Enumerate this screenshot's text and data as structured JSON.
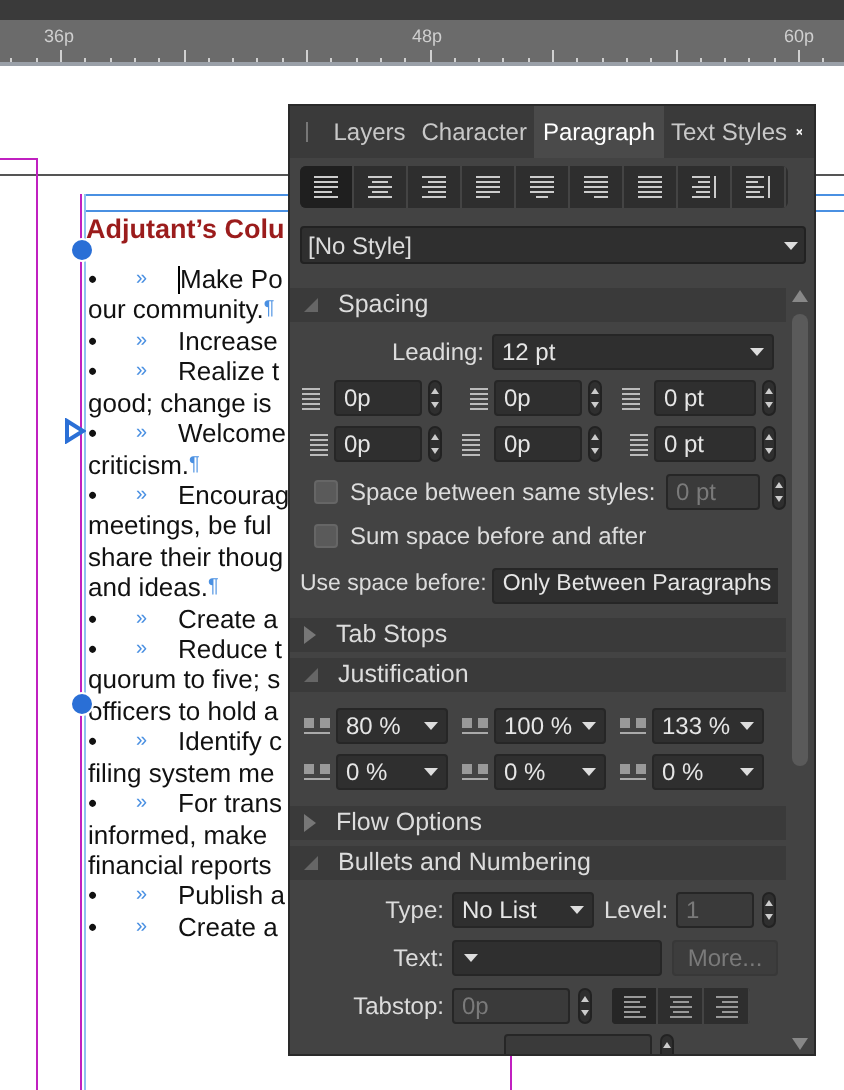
{
  "ruler": {
    "labels": [
      "36p",
      "48p",
      "60p"
    ]
  },
  "document": {
    "heading": "Adjutant’s Colu",
    "lines": [
      {
        "bullet": "•",
        "tab": "»",
        "text": "Make Po",
        "cursor": true
      },
      {
        "text": "our community.",
        "end_mark": "¶"
      },
      {
        "bullet": "•",
        "tab": "»",
        "text": "Increase"
      },
      {
        "bullet": "•",
        "tab": "»",
        "text": "Realize t"
      },
      {
        "text": "good; change is"
      },
      {
        "bullet": "•",
        "tab": "»",
        "text": "Welcome"
      },
      {
        "text": "criticism.",
        "end_mark": "¶"
      },
      {
        "bullet": "•",
        "tab": "»",
        "text": "Encourag"
      },
      {
        "text": "meetings, be ful"
      },
      {
        "text": "share their thoug"
      },
      {
        "text": "and ideas.",
        "end_mark": "¶"
      },
      {
        "bullet": "•",
        "tab": "»",
        "text": "Create a"
      },
      {
        "bullet": "•",
        "tab": "»",
        "text": "Reduce t"
      },
      {
        "text": "quorum to five; s"
      },
      {
        "text": "officers to hold a"
      },
      {
        "bullet": "•",
        "tab": "»",
        "text": "Identify c"
      },
      {
        "text": "filing system me"
      },
      {
        "bullet": "•",
        "tab": "»",
        "text": "For trans"
      },
      {
        "text": "informed, make"
      },
      {
        "text": "financial reports"
      },
      {
        "bullet": "•",
        "tab": "»",
        "text": "Publish a"
      },
      {
        "bullet": "•",
        "tab": "»",
        "text": "Create a"
      }
    ]
  },
  "panel": {
    "tabs": [
      {
        "label": "Layers",
        "selected": false
      },
      {
        "label": "Character",
        "selected": false
      },
      {
        "label": "Paragraph",
        "selected": true
      },
      {
        "label": "Text Styles",
        "selected": false
      }
    ],
    "alignment_buttons": [
      {
        "selected": true
      },
      {
        "selected": false
      },
      {
        "selected": false
      },
      {
        "selected": false
      },
      {
        "selected": false
      },
      {
        "selected": false
      },
      {
        "selected": false
      },
      {
        "selected": false
      },
      {
        "selected": false
      }
    ],
    "style": "[No Style]",
    "sections": [
      {
        "kind": "spacing",
        "title": "Spacing",
        "expanded": true,
        "leading_label": "Leading:",
        "leading": "12 pt",
        "values": [
          "0p",
          "0p",
          "0 pt",
          "0p",
          "0p",
          "0 pt"
        ],
        "same_styles": {
          "label": "Space between same styles:",
          "checked": false,
          "value": "0 pt",
          "disabled": true
        },
        "sum_space": {
          "label": "Sum space before and after",
          "checked": false
        },
        "use_space_before_label": "Use space before:",
        "use_space_before": "Only Between Paragraphs"
      },
      {
        "kind": "collapsed",
        "title": "Tab Stops",
        "expanded": false
      },
      {
        "kind": "justification",
        "title": "Justification",
        "expanded": true,
        "values": [
          "80 %",
          "100 %",
          "133 %",
          "0 %",
          "0 %",
          "0 %"
        ]
      },
      {
        "kind": "collapsed",
        "title": "Flow Options",
        "expanded": false
      },
      {
        "kind": "bullets",
        "title": "Bullets and Numbering",
        "expanded": true,
        "type_label": "Type:",
        "type": "No List",
        "level_label": "Level:",
        "level": "1",
        "level_disabled": true,
        "text_label": "Text:",
        "more": "More...",
        "more_disabled": true,
        "tabstop_label": "Tabstop:",
        "tabstop": "0p",
        "tabstop_disabled": true,
        "tab_align": [
          {
            "selected": true
          },
          {
            "selected": false
          },
          {
            "selected": false
          }
        ]
      }
    ]
  }
}
